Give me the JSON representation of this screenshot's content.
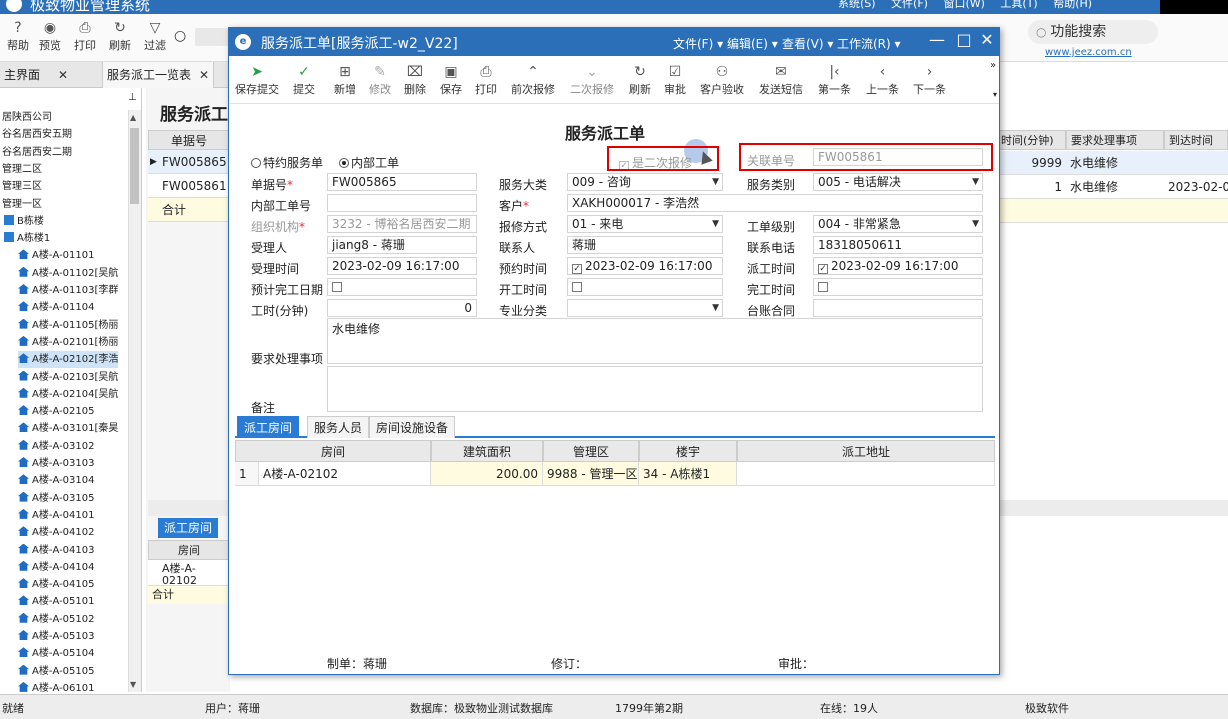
{
  "app": {
    "title": "极致物业管理系统",
    "menu": "系统(S)  文件(F)  窗口(W)  工具(T)  帮助(H)"
  },
  "main_toolbar": [
    {
      "label": "帮助",
      "icon": "help-icon"
    },
    {
      "label": "预览",
      "icon": "eye-icon"
    },
    {
      "label": "打印",
      "icon": "printer-icon"
    },
    {
      "label": "刷新",
      "icon": "refresh-icon"
    },
    {
      "label": "过滤",
      "icon": "filter-icon"
    }
  ],
  "feature_search": "功能搜索",
  "website": "www.jeez.com.cn",
  "tabs": [
    {
      "label": "主界面"
    },
    {
      "label": "服务派工一览表"
    }
  ],
  "tree": [
    "居陕西公司",
    "谷名居西安五期",
    "谷名居西安二期",
    "管理二区",
    "管理三区",
    "管理一区",
    "B栋楼",
    "A栋楼1",
    "A楼-A-01101",
    "A楼-A-01102[吴航",
    "A楼-A-01103[李群",
    "A楼-A-01104",
    "A楼-A-01105[杨丽",
    "A楼-A-02101[杨丽",
    "A楼-A-02102[李浩",
    "A楼-A-02103[吴航",
    "A楼-A-02104[吴航",
    "A楼-A-02105",
    "A楼-A-03101[秦昊",
    "A楼-A-03102",
    "A楼-A-03103",
    "A楼-A-03104",
    "A楼-A-03105",
    "A楼-A-04101",
    "A楼-A-04102",
    "A楼-A-04103",
    "A楼-A-04104",
    "A楼-A-04105",
    "A楼-A-05101",
    "A楼-A-05102",
    "A楼-A-05103",
    "A楼-A-05104",
    "A楼-A-05105",
    "A楼-A-06101"
  ],
  "list": {
    "title": "服务派工",
    "col_header": "单据号",
    "rows": [
      "FW005865",
      "FW005861"
    ],
    "sum_label": "合计",
    "right_headers": [
      "时间(分钟)",
      "要求处理事项",
      "到达时间"
    ],
    "right_rows": [
      [
        "9999",
        "水电维修",
        ""
      ],
      [
        "1",
        "水电维修",
        "2023-02-0"
      ]
    ]
  },
  "lower": {
    "tab": "派工房间",
    "col_header": "房间",
    "row": "A楼-A-02102",
    "sum_label": "合计"
  },
  "dialog": {
    "title": "服务派工单[服务派工-w2_V22]",
    "menu": [
      "文件(F)",
      "编辑(E)",
      "查看(V)",
      "工作流(R)"
    ],
    "toolbar": [
      {
        "label": "保存提交",
        "icon": "send-icon",
        "enabled": true
      },
      {
        "label": "提交",
        "icon": "check-circle-icon",
        "enabled": true
      },
      {
        "label": "新增",
        "icon": "add-doc-icon",
        "enabled": true
      },
      {
        "label": "修改",
        "icon": "edit-icon",
        "enabled": false
      },
      {
        "label": "删除",
        "icon": "trash-icon",
        "enabled": true
      },
      {
        "label": "保存",
        "icon": "save-icon",
        "enabled": true
      },
      {
        "label": "打印",
        "icon": "printer-icon",
        "enabled": true
      },
      {
        "label": "前次报修",
        "icon": "chevron-up-icon",
        "enabled": true
      },
      {
        "label": "二次报修",
        "icon": "chevron-down-icon",
        "enabled": false
      },
      {
        "label": "刷新",
        "icon": "refresh-icon",
        "enabled": true
      },
      {
        "label": "审批",
        "icon": "approve-icon",
        "enabled": true
      },
      {
        "label": "客户验收",
        "icon": "user-icon",
        "enabled": true
      },
      {
        "label": "发送短信",
        "icon": "message-icon",
        "enabled": true
      },
      {
        "label": "第一条",
        "icon": "first-icon",
        "enabled": true
      },
      {
        "label": "上一条",
        "icon": "prev-icon",
        "enabled": true
      },
      {
        "label": "下一条",
        "icon": "next-icon",
        "enabled": true
      }
    ],
    "form_title": "服务派工单",
    "radio_special": "特约服务单",
    "radio_internal": "内部工单",
    "second_repair": "是二次报修",
    "fields": {
      "related_no_label": "关联单号",
      "related_no": "FW005861",
      "bill_no_label": "单据号",
      "bill_no": "FW005865",
      "service_cat_label": "服务大类",
      "service_cat": "009 - 咨询",
      "service_type_label": "服务类别",
      "service_type": "005 - 电话解决",
      "internal_no_label": "内部工单号",
      "internal_no": "",
      "customer_label": "客户",
      "customer": "XAKH000017 - 李浩然",
      "org_label": "组织机构",
      "org": "3232 - 博裕名居西安二期",
      "repair_mode_label": "报修方式",
      "repair_mode": "01 - 来电",
      "level_label": "工单级别",
      "level": "004 - 非常紧急",
      "receiver_label": "受理人",
      "receiver": "jiang8 - 蒋珊",
      "contact_label": "联系人",
      "contact": "蒋珊",
      "phone_label": "联系电话",
      "phone": "18318050611",
      "receive_time_label": "受理时间",
      "receive_time": "2023-02-09 16:17:00",
      "appoint_time_label": "预约时间",
      "appoint_time": "2023-02-09 16:17:00",
      "dispatch_time_label": "派工时间",
      "dispatch_time": "2023-02-09 16:17:00",
      "expect_date_label": "预计完工日期",
      "start_time_label": "开工时间",
      "finish_time_label": "完工时间",
      "minutes_label": "工时(分钟)",
      "minutes": "0",
      "specialty_label": "专业分类",
      "specialty": "",
      "contract_label": "台账合同",
      "contract": "",
      "request_label": "要求处理事项",
      "request": "水电维修",
      "remark_label": "备注",
      "remark": ""
    },
    "tabs": [
      "派工房间",
      "服务人员",
      "房间设施设备"
    ],
    "grid_headers": [
      "房间",
      "建筑面积",
      "管理区",
      "楼宇",
      "派工地址"
    ],
    "grid_row": {
      "index": "1",
      "room": "A楼-A-02102",
      "area": "200.00",
      "zone": "9988 - 管理一区",
      "building": "34 - A栋楼1",
      "address": ""
    },
    "footer": {
      "maker": "制单：蒋珊",
      "modifier": "修订：",
      "approver": "审批："
    }
  },
  "status": {
    "left": "就绪",
    "user": "用户：蒋珊",
    "db": "数据库：极致物业测试数据库",
    "period": "1799年第2期",
    "online": "在线：19人",
    "vendor": "极致软件"
  }
}
